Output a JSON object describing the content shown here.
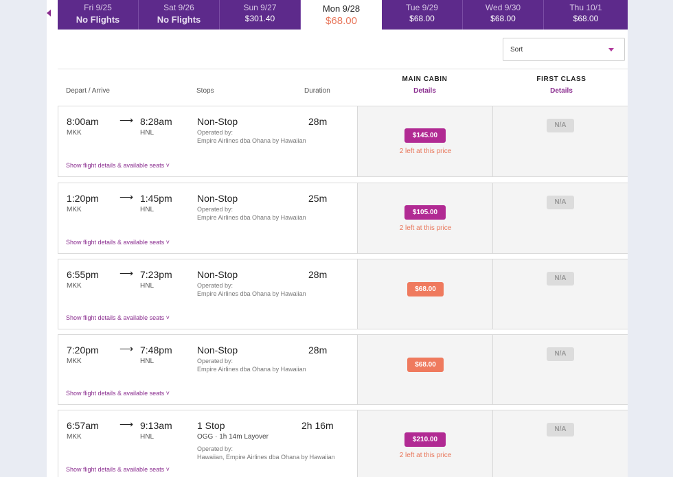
{
  "date_strip": {
    "tabs": [
      {
        "date": "Fri 9/25",
        "price": "No Flights",
        "no_flights": true
      },
      {
        "date": "Sat 9/26",
        "price": "No Flights",
        "no_flights": true
      },
      {
        "date": "Sun 9/27",
        "price": "$301.40"
      },
      {
        "date": "Mon 9/28",
        "price": "$68.00",
        "active": true
      },
      {
        "date": "Tue 9/29",
        "price": "$68.00"
      },
      {
        "date": "Wed 9/30",
        "price": "$68.00"
      },
      {
        "date": "Thu 10/1",
        "price": "$68.00"
      }
    ]
  },
  "sort": {
    "label": "Sort"
  },
  "header": {
    "depart_arrive": "Depart / Arrive",
    "stops": "Stops",
    "duration": "Duration",
    "main_cabin": "MAIN CABIN",
    "main_cabin_details": "Details",
    "first_class": "FIRST CLASS",
    "first_class_details": "Details"
  },
  "flights": [
    {
      "depart": "8:00am",
      "arrive": "8:28am",
      "from": "MKK",
      "to": "HNL",
      "stops": "Non-Stop",
      "layover": "",
      "operated_label": "Operated by:",
      "operator": "Empire Airlines dba Ohana by Hawaiian",
      "duration": "28m",
      "main_price": "$145.00",
      "main_note": "2 left at this price",
      "price_style": "purple",
      "first": "N/A",
      "show_details": "Show flight details & available seats ˅"
    },
    {
      "depart": "1:20pm",
      "arrive": "1:45pm",
      "from": "MKK",
      "to": "HNL",
      "stops": "Non-Stop",
      "layover": "",
      "operated_label": "Operated by:",
      "operator": "Empire Airlines dba Ohana by Hawaiian",
      "duration": "25m",
      "main_price": "$105.00",
      "main_note": "2 left at this price",
      "price_style": "purple",
      "first": "N/A",
      "show_details": "Show flight details & available seats ˅"
    },
    {
      "depart": "6:55pm",
      "arrive": "7:23pm",
      "from": "MKK",
      "to": "HNL",
      "stops": "Non-Stop",
      "layover": "",
      "operated_label": "Operated by:",
      "operator": "Empire Airlines dba Ohana by Hawaiian",
      "duration": "28m",
      "main_price": "$68.00",
      "main_note": "",
      "price_style": "salmon",
      "first": "N/A",
      "show_details": "Show flight details & available seats ˅"
    },
    {
      "depart": "7:20pm",
      "arrive": "7:48pm",
      "from": "MKK",
      "to": "HNL",
      "stops": "Non-Stop",
      "layover": "",
      "operated_label": "Operated by:",
      "operator": "Empire Airlines dba Ohana by Hawaiian",
      "duration": "28m",
      "main_price": "$68.00",
      "main_note": "",
      "price_style": "salmon",
      "first": "N/A",
      "show_details": "Show flight details & available seats ˅"
    },
    {
      "depart": "6:57am",
      "arrive": "9:13am",
      "from": "MKK",
      "to": "HNL",
      "stops": "1 Stop",
      "layover": "OGG · 1h 14m Layover",
      "operated_label": "Operated by:",
      "operator": "Hawaiian, Empire Airlines dba Ohana by Hawaiian",
      "duration": "2h 16m",
      "main_price": "$210.00",
      "main_note": "2 left at this price",
      "price_style": "purple",
      "first": "N/A",
      "show_details": "Show flight details & available seats ˅"
    }
  ],
  "colors": {
    "brand_purple": "#5d2a8b",
    "price_purple": "#b12a93",
    "price_salmon": "#ef7a5e"
  }
}
